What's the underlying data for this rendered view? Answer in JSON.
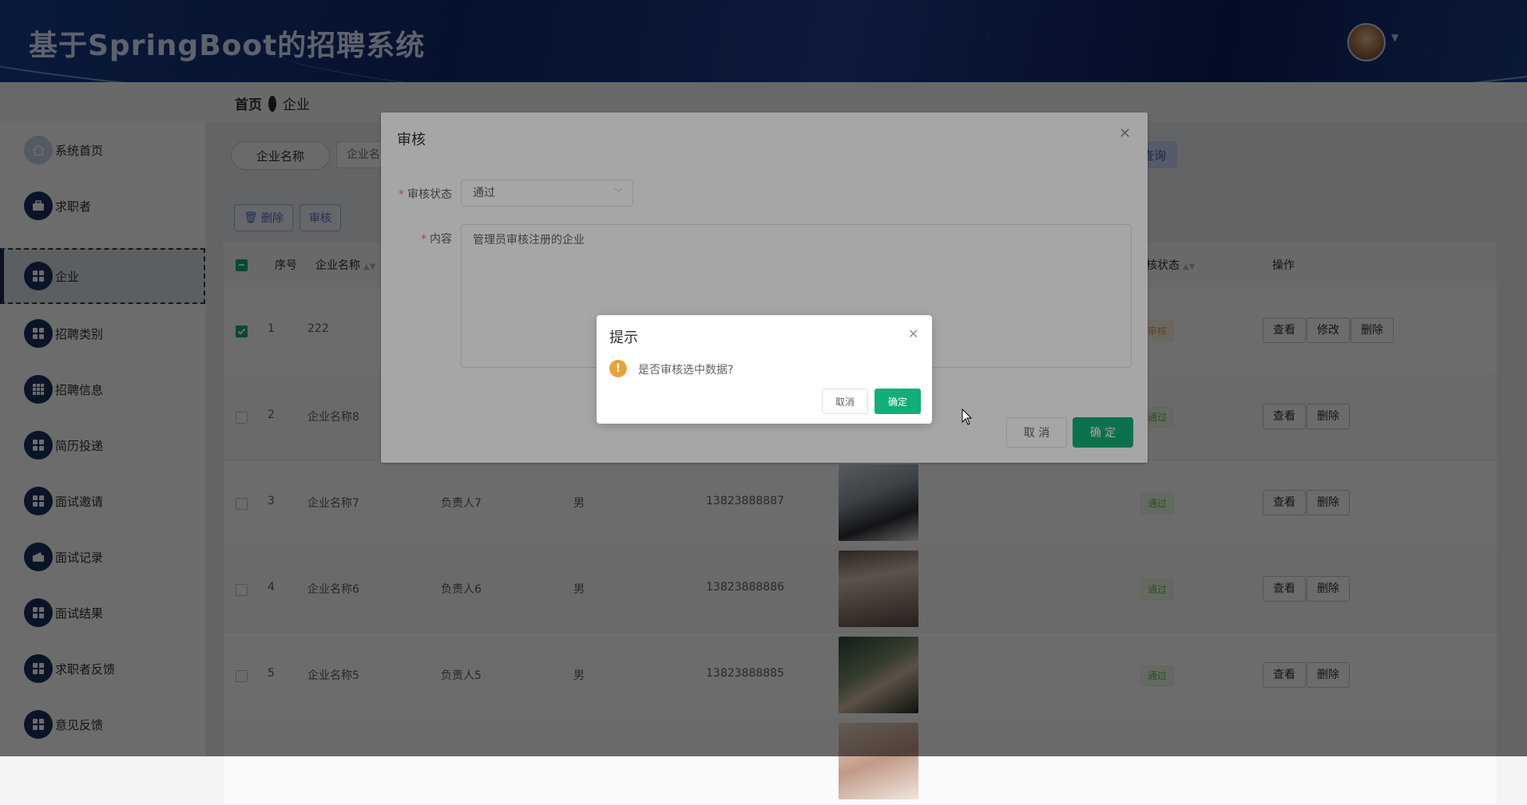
{
  "app": {
    "title": "基于SpringBoot的招聘系统"
  },
  "breadcrumb": {
    "home": "首页",
    "current": "企业"
  },
  "sidebar": {
    "items": [
      {
        "label": "系统首页",
        "icon": "home-icon"
      },
      {
        "label": "求职者",
        "icon": "briefcase-icon"
      },
      {
        "label": "企业",
        "icon": "grid-icon",
        "active": true
      },
      {
        "label": "招聘类别",
        "icon": "grid-icon"
      },
      {
        "label": "招聘信息",
        "icon": "grid9-icon"
      },
      {
        "label": "简历投递",
        "icon": "grid-icon"
      },
      {
        "label": "面试邀请",
        "icon": "grid-icon"
      },
      {
        "label": "面试记录",
        "icon": "wallet-icon"
      },
      {
        "label": "面试结果",
        "icon": "grid-icon"
      },
      {
        "label": "求职者反馈",
        "icon": "grid-icon"
      },
      {
        "label": "意见反馈",
        "icon": "grid-icon"
      }
    ]
  },
  "search": {
    "label": "企业名称",
    "placeholder": "企业名",
    "query_label": "查询"
  },
  "toolbar": {
    "delete_label": "删除",
    "audit_label": "审核"
  },
  "table": {
    "headers": {
      "index": "序号",
      "company": "企业名称",
      "audit_status": "核状态",
      "actions": "操作"
    },
    "rows": [
      {
        "index": "1",
        "company": "222",
        "person": "",
        "gender": "",
        "phone": "",
        "status": "审核",
        "status_type": "pending",
        "checked": true,
        "actions": [
          "查看",
          "修改",
          "删除"
        ]
      },
      {
        "index": "2",
        "company": "企业名称8",
        "person": "",
        "gender": "",
        "phone": "",
        "status": "通过",
        "status_type": "pass",
        "checked": false,
        "actions": [
          "查看",
          "删除"
        ]
      },
      {
        "index": "3",
        "company": "企业名称7",
        "person": "负责人7",
        "gender": "男",
        "phone": "13823888887",
        "status": "通过",
        "status_type": "pass",
        "checked": false,
        "actions": [
          "查看",
          "删除"
        ]
      },
      {
        "index": "4",
        "company": "企业名称6",
        "person": "负责人6",
        "gender": "男",
        "phone": "13823888886",
        "status": "通过",
        "status_type": "pass",
        "checked": false,
        "actions": [
          "查看",
          "删除"
        ]
      },
      {
        "index": "5",
        "company": "企业名称5",
        "person": "负责人5",
        "gender": "男",
        "phone": "13823888885",
        "status": "通过",
        "status_type": "pass",
        "checked": false,
        "actions": [
          "查看",
          "删除"
        ]
      }
    ]
  },
  "audit_dialog": {
    "title": "审核",
    "status_label": "审核状态",
    "status_value": "通过",
    "content_label": "内容",
    "content_value": "管理员审核注册的企业",
    "cancel_label": "取 消",
    "ok_label": "确 定"
  },
  "confirm_box": {
    "title": "提示",
    "message": "是否审核选中数据?",
    "cancel_label": "取消",
    "ok_label": "确定"
  },
  "colors": {
    "brand": "#13ae77",
    "header": "#1a3d8a",
    "sidebar_icon": "#1d2f5f"
  }
}
